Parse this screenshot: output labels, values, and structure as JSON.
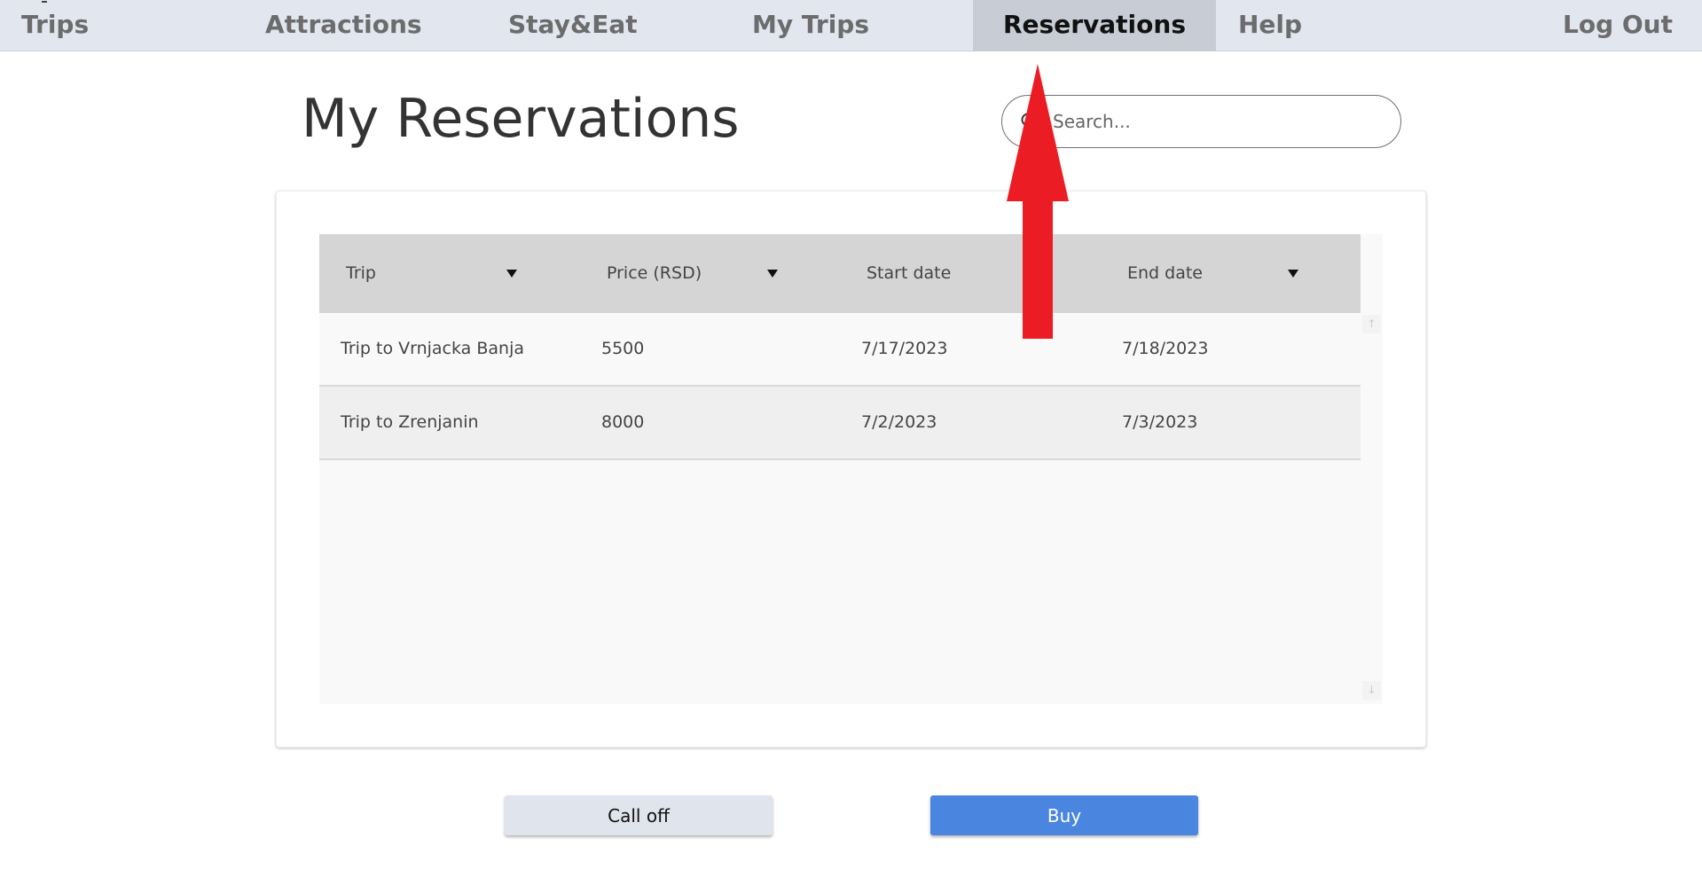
{
  "nav": {
    "items": [
      {
        "label": "Trips"
      },
      {
        "label": "Attractions"
      },
      {
        "label": "Stay&Eat"
      },
      {
        "label": "My Trips"
      },
      {
        "label": "Reservations",
        "active": true
      },
      {
        "label": "Help"
      }
    ],
    "logout_label": "Log Out"
  },
  "page": {
    "title": "My Reservations"
  },
  "search": {
    "placeholder": "Search...",
    "value": ""
  },
  "table": {
    "columns": [
      {
        "label": "Trip",
        "sortable": true
      },
      {
        "label": "Price (RSD)",
        "sortable": true
      },
      {
        "label": "Start date",
        "sortable": false
      },
      {
        "label": "End date",
        "sortable": true
      }
    ],
    "rows": [
      {
        "trip": "Trip to Vrnjacka Banja",
        "price": "5500",
        "start": "7/17/2023",
        "end": "7/18/2023"
      },
      {
        "trip": "Trip to Zrenjanin",
        "price": "8000",
        "start": "7/2/2023",
        "end": "7/3/2023"
      }
    ]
  },
  "actions": {
    "call_off_label": "Call off",
    "buy_label": "Buy"
  },
  "colors": {
    "nav_bg": "#e1e6ef",
    "nav_active_bg": "#c8ccd5",
    "buy_button": "#4a86e0",
    "call_off_button": "#dfe4ed",
    "annotation_arrow": "#ec1c24"
  },
  "icons": {
    "search": "search-icon",
    "sort": "sort-down-triangle-icon",
    "scroll_up": "scroll-up-arrow-icon",
    "scroll_down": "scroll-down-arrow-icon"
  }
}
